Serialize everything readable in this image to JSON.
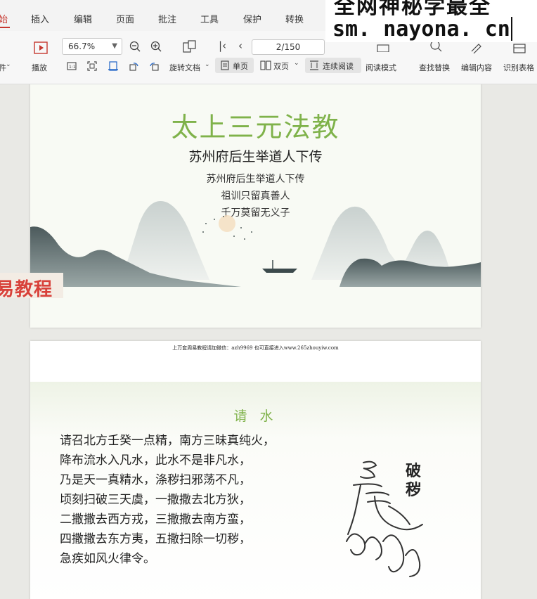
{
  "menu": {
    "items": [
      {
        "label": "始",
        "active": true
      },
      {
        "label": "插入"
      },
      {
        "label": "编辑"
      },
      {
        "label": "页面"
      },
      {
        "label": "批注"
      },
      {
        "label": "工具"
      },
      {
        "label": "保护"
      },
      {
        "label": "转换"
      }
    ]
  },
  "watermark": {
    "line1": "全网神秘学最全",
    "line2": "sm. nayona. cn"
  },
  "toolbar": {
    "left_partial": "件",
    "play_label": "播放",
    "zoom_value": "66.7%",
    "page_value": "2/150",
    "rotate_label": "旋转文档",
    "single_page_label": "单页",
    "double_page_label": "双页",
    "continuous_label": "连续阅读",
    "read_mode_label": "阅读模式",
    "find_replace_label": "查找替换",
    "edit_content_label": "编辑内容",
    "recognize_table_label": "识别表格",
    "icons": [
      "play-icon",
      "zoom-out-icon",
      "zoom-in-icon",
      "page-layout-icon",
      "first-page-icon",
      "prev-page-icon",
      "actual-size-icon",
      "fit-page-icon",
      "fit-width-icon",
      "rotate-left-icon",
      "rotate-right-icon",
      "single-page-icon",
      "double-page-icon",
      "continuous-icon",
      "search-icon",
      "edit-icon",
      "table-icon"
    ]
  },
  "side_banner": "易教程",
  "page1": {
    "title": "太上三元法教",
    "subtitle": "苏州府后生举道人下传",
    "lines": [
      "苏州府后生举道人下传",
      "祖训只留真善人",
      "千万莫留无义子"
    ]
  },
  "page2": {
    "header": "上万套周易教程请加微信：azh9969   也可直接进入www.265zhouyiw.com",
    "title": "请 水",
    "poem": [
      "请召北方壬癸一点精，南方三昧真纯火，",
      "降布流水入凡水，此水不是非凡水，",
      "乃是天一真精水，涤秽扫邪荡不凡，",
      "顷刻扫破三天虞，一撒撒去北方狄，",
      "二撒撒去西方戎，三撒撒去南方蛮，",
      "四撒撒去东方夷，五撒扫除一切秽，",
      "急疾如风火律令。"
    ],
    "talisman_label_1": "破",
    "talisman_label_2": "秽"
  }
}
